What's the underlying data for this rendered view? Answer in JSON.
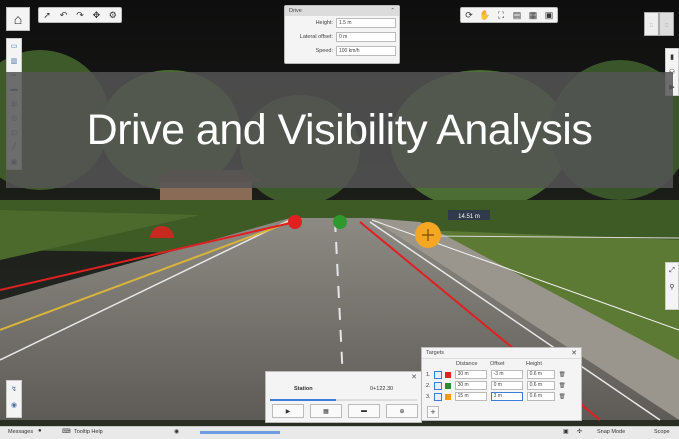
{
  "banner": {
    "title": "Drive and Visibility Analysis"
  },
  "drive_panel": {
    "title": "Drive",
    "height_label": "Height:",
    "height_value": "1.5 m",
    "offset_label": "Lateral offset:",
    "offset_value": "0 m",
    "speed_label": "Speed:",
    "speed_value": "100 km/h"
  },
  "scene": {
    "distance_badge": "14.51 m"
  },
  "station_panel": {
    "title": "Station",
    "value": "0+122.30",
    "progress": 0.45
  },
  "targets_panel": {
    "title": "Targets",
    "columns": [
      "Distance",
      "Offset",
      "Height"
    ],
    "rows": [
      {
        "index": "1.",
        "color": "#d52b1e",
        "distance": "30 m",
        "offset": "-3 m",
        "height": "0.6 m"
      },
      {
        "index": "2.",
        "color": "#2e8b2e",
        "distance": "30 m",
        "offset": "0 m",
        "height": "0.6 m"
      },
      {
        "index": "3.",
        "color": "#f39c12",
        "distance": "15 m",
        "offset": "3 m",
        "height": "0.6 m"
      }
    ]
  },
  "statusbar": {
    "messages": "Messages",
    "tooltip": "Tooltip Help",
    "snap": "Snap Mode",
    "scope": "Scope"
  },
  "colors": {
    "accent": "#3b7dd8",
    "target_red": "#d52b1e",
    "target_green": "#2e8b2e",
    "target_orange": "#f39c12"
  }
}
